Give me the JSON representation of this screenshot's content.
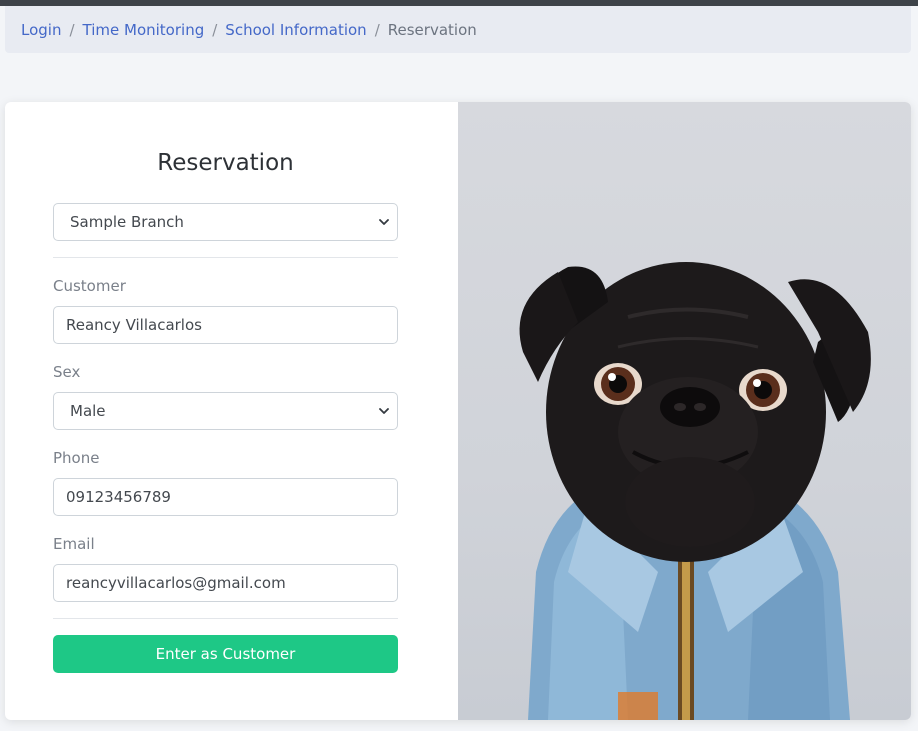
{
  "breadcrumb": {
    "items": [
      "Login",
      "Time Monitoring",
      "School Information"
    ],
    "current": "Reservation",
    "separator": "/"
  },
  "form": {
    "title": "Reservation",
    "branch_selected": "Sample Branch",
    "customer_label": "Customer",
    "customer_value": "Reancy Villacarlos",
    "sex_label": "Sex",
    "sex_selected": "Male",
    "phone_label": "Phone",
    "phone_value": "09123456789",
    "email_label": "Email",
    "email_value": "reancyvillacarlos@gmail.com",
    "submit_label": "Enter as Customer"
  },
  "image": {
    "subject": "pug-in-denim-jacket-photo"
  },
  "colors": {
    "accent_button": "#1ec886",
    "link": "#4468c8"
  }
}
